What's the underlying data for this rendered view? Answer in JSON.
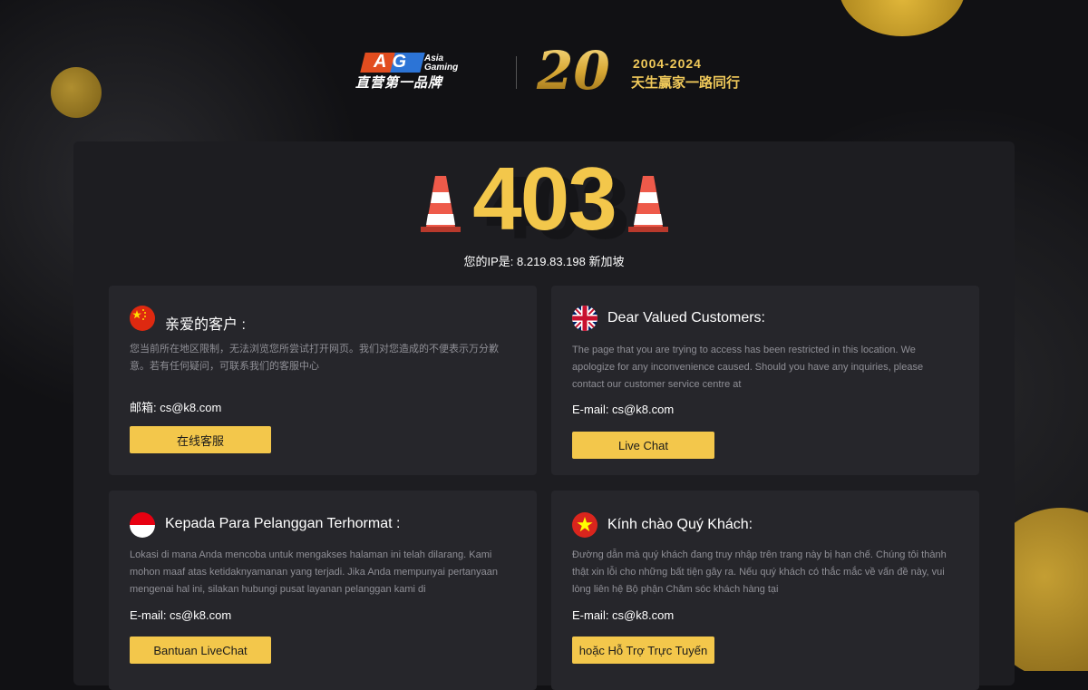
{
  "header": {
    "ag_logo": {
      "letters": "AG",
      "brand": "Asia Gaming",
      "tagline": "直营第一品牌"
    },
    "anniversary": {
      "number": "20",
      "years": "2004-2024",
      "slogan": "天生赢家一路同行"
    }
  },
  "error": {
    "code": "403",
    "ip_text": "您的IP是:  8.219.83.198 新加坡"
  },
  "cards": {
    "cn": {
      "title": "亲爱的客户 :",
      "desc": "您当前所在地区限制，无法浏览您所尝试打开网页。我们对您造成的不便表示万分歉意。若有任何疑问，可联系我们的客服中心",
      "email": "邮箱: cs@k8.com",
      "button": "在线客服"
    },
    "en": {
      "title": "Dear Valued Customers:",
      "desc": "The page that you are trying to access has been restricted in this location. We apologize for any inconvenience caused. Should you have any inquiries, please contact our customer service centre at",
      "email": "E-mail: cs@k8.com",
      "button": "Live Chat"
    },
    "id": {
      "title": "Kepada Para Pelanggan Terhormat :",
      "desc": "Lokasi di mana Anda mencoba untuk mengakses halaman ini telah dilarang. Kami mohon maaf atas ketidaknyamanan yang terjadi. Jika Anda mempunyai pertanyaan mengenai hal ini, silakan hubungi pusat layanan pelanggan kami di",
      "email": "E-mail: cs@k8.com",
      "button": "Bantuan LiveChat"
    },
    "vn": {
      "title": "Kính chào Quý Khách:",
      "desc": "Đường dẫn mà quý khách đang truy nhập trên trang này bị hạn chế. Chúng tôi thành thật xin lỗi cho những bất tiện gây ra. Nếu quý khách có thắc mắc về vấn đề này, vui lòng liên hệ Bộ phận Chăm sóc khách hàng tại",
      "email": "E-mail: cs@k8.com",
      "button": "hoặc Hỗ Trợ Trực Tuyến"
    }
  },
  "colors": {
    "accent": "#f3c74b",
    "background": "#111114",
    "panel": "#1d1d21",
    "card": "#26262b"
  }
}
